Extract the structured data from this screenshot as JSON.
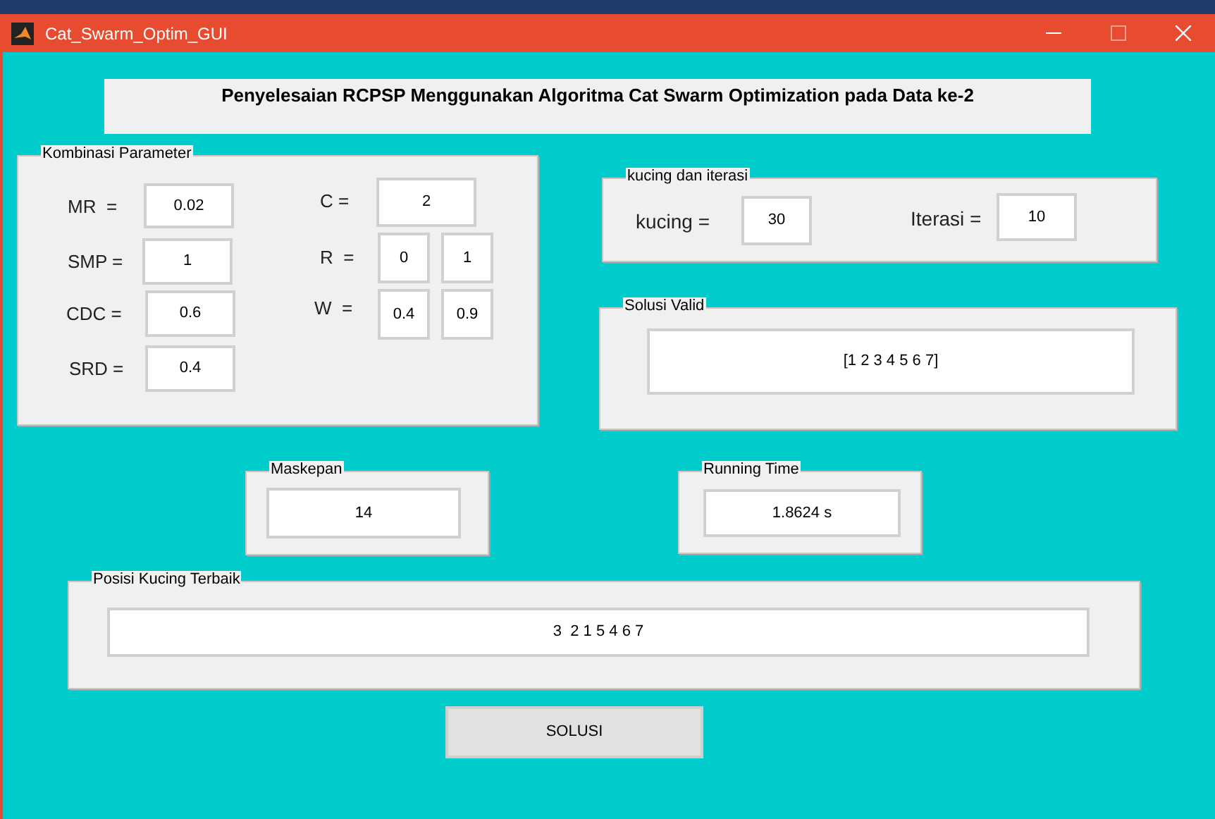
{
  "window": {
    "title": "Cat_Swarm_Optim_GUI"
  },
  "heading": "Penyelesaian RCPSP Menggunakan Algoritma Cat Swarm Optimization pada Data ke-2",
  "parameters": {
    "title": "Kombinasi Parameter",
    "mr": {
      "label": "MR  =",
      "value": "0.02"
    },
    "smp": {
      "label": "SMP =",
      "value": "1"
    },
    "cdc": {
      "label": "CDC =",
      "value": "0.6"
    },
    "srd": {
      "label": "SRD =",
      "value": "0.4"
    },
    "c": {
      "label": "C =",
      "value": "2"
    },
    "r": {
      "label": "R  =",
      "values": [
        "0",
        "1"
      ]
    },
    "w": {
      "label": "W  =",
      "values": [
        "0.4",
        "0.9"
      ]
    }
  },
  "cats_iterations": {
    "title": "kucing dan iterasi",
    "cats": {
      "label": "kucing =",
      "value": "30"
    },
    "iterations": {
      "label": "Iterasi =",
      "value": "10"
    }
  },
  "valid_solution": {
    "title": "Solusi Valid",
    "value": "[1 2 3 4 5 6 7]"
  },
  "makespan": {
    "title": "Maskepan",
    "value": "14"
  },
  "running_time": {
    "title": "Running Time",
    "value": "1.8624 s"
  },
  "best_cat_position": {
    "title": "Posisi Kucing Terbaik",
    "value": "3  2 1 5 4 6 7"
  },
  "solve_button": "SOLUSI"
}
